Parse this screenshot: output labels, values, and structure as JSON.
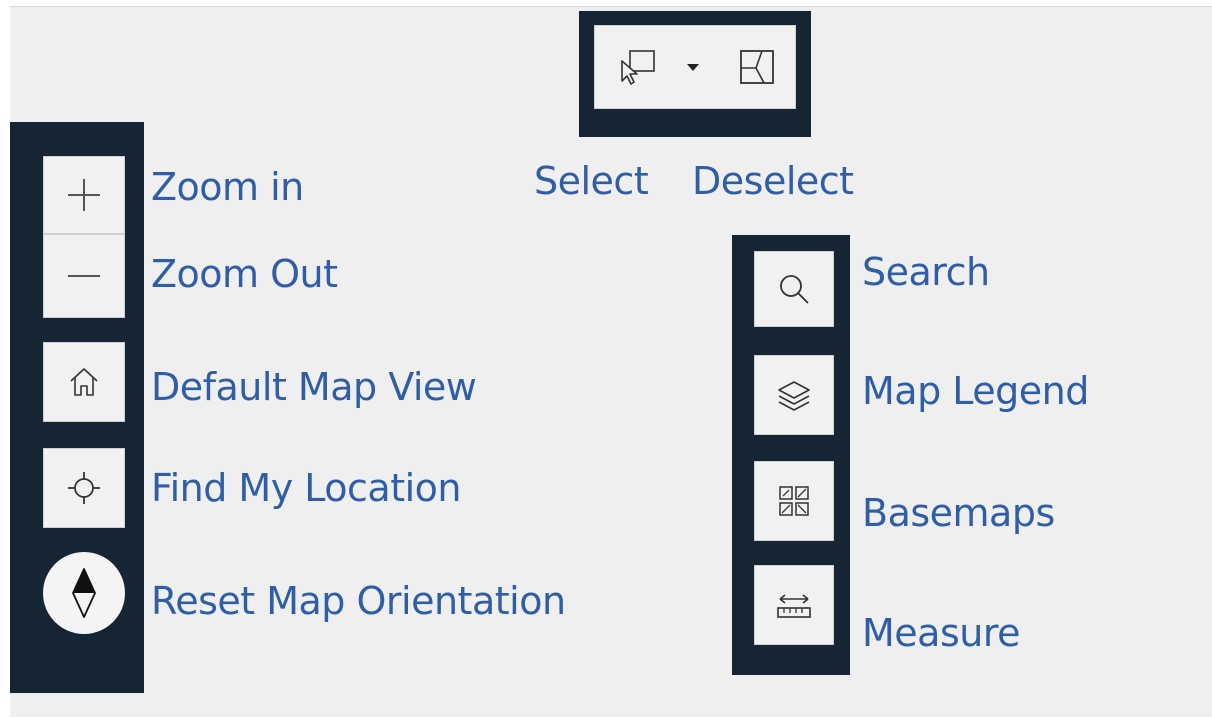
{
  "left_toolbar": {
    "zoom_in": {
      "icon": "plus-icon",
      "label": "Zoom in"
    },
    "zoom_out": {
      "icon": "minus-icon",
      "label": "Zoom Out"
    },
    "default_view": {
      "icon": "home-icon",
      "label": "Default Map View"
    },
    "find_location": {
      "icon": "crosshair-icon",
      "label": "Find My Location"
    },
    "reset_orientation": {
      "icon": "compass-icon",
      "label": "Reset Map Orientation"
    }
  },
  "top_toolbar": {
    "select": {
      "icon": "select-cursor-icon",
      "label": "Select"
    },
    "dropdown": {
      "icon": "caret-down-icon"
    },
    "deselect": {
      "icon": "deselect-icon",
      "label": "Deselect"
    }
  },
  "right_toolbar": {
    "search": {
      "icon": "search-icon",
      "label": "Search"
    },
    "legend": {
      "icon": "layers-icon",
      "label": "Map Legend"
    },
    "basemaps": {
      "icon": "basemap-grid-icon",
      "label": "Basemaps"
    },
    "measure": {
      "icon": "ruler-icon",
      "label": "Measure"
    }
  },
  "colors": {
    "panel": "#162534",
    "label": "#2f5ea6",
    "background": "#efefef",
    "button": "#f1f1f1"
  }
}
